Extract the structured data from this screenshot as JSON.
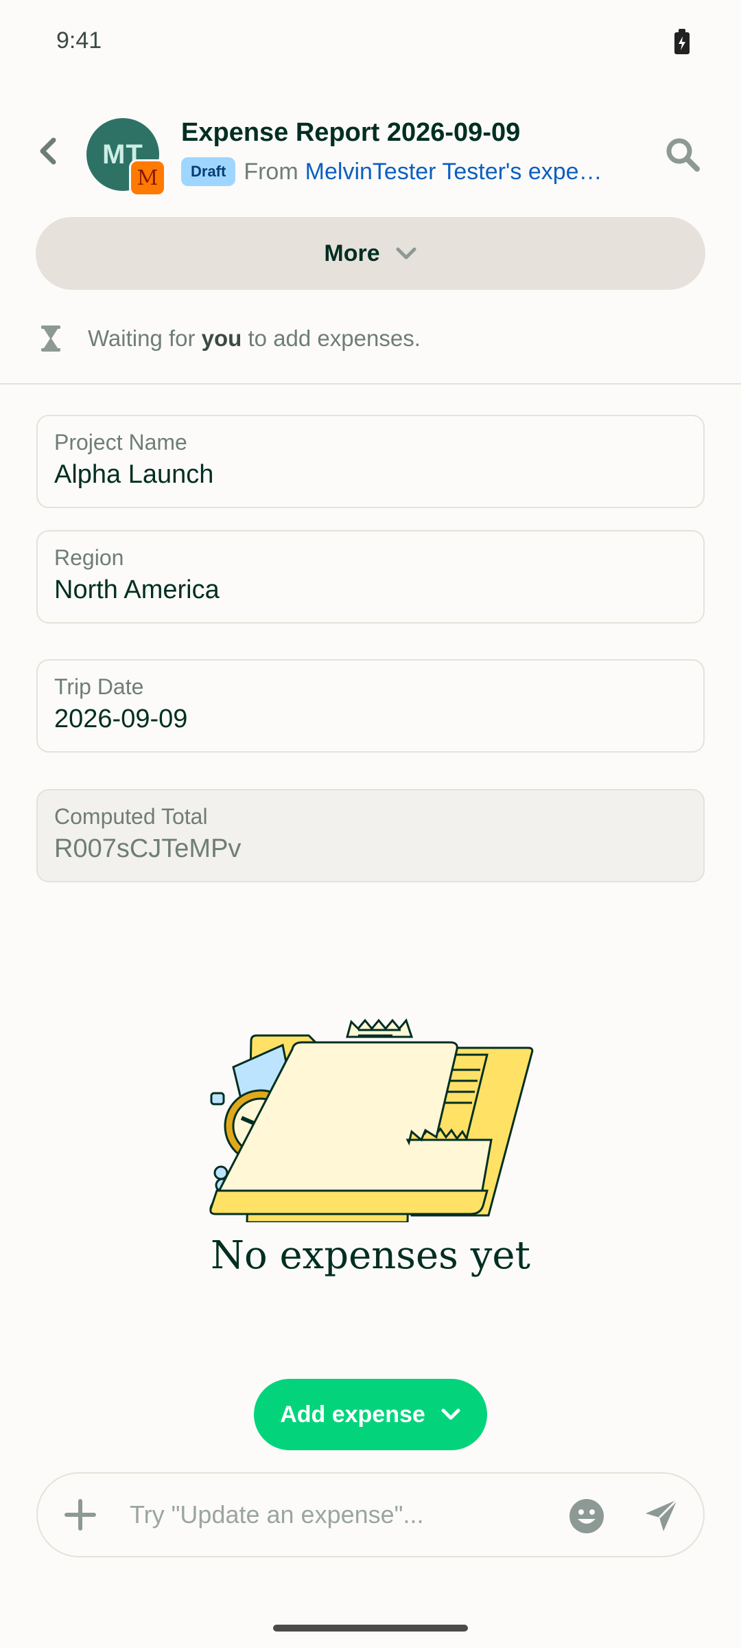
{
  "status_bar": {
    "time": "9:41",
    "battery_icon": "battery-charging-icon"
  },
  "header": {
    "avatar_initials": "MT",
    "workspace_badge": "M",
    "title": "Expense Report 2026-09-09",
    "status_badge": "Draft",
    "from_prefix": "From",
    "from_link": "MelvinTester Tester's expen…"
  },
  "more_button": {
    "label": "More"
  },
  "waiting": {
    "prefix": "Waiting for",
    "emphasis": "you",
    "suffix": "to add expenses."
  },
  "fields": [
    {
      "label": "Project Name",
      "value": "Alpha Launch"
    },
    {
      "label": "Region",
      "value": "North America"
    },
    {
      "label": "Trip Date",
      "value": "2026-09-09"
    },
    {
      "label": "Computed Total",
      "value": "R007sCJTeMPv"
    }
  ],
  "empty_state": {
    "title": "No expenses yet"
  },
  "add_button": {
    "label": "Add expense"
  },
  "composer": {
    "placeholder": "Try \"Update an expense\"..."
  },
  "colors": {
    "background": "#FCFBF9",
    "text": "#002E22",
    "muted": "#6E7D78",
    "accent_green": "#03D47C",
    "link_blue": "#0B5FC1",
    "draft_badge": "#9FD6FF",
    "border": "#E6E1DA"
  }
}
